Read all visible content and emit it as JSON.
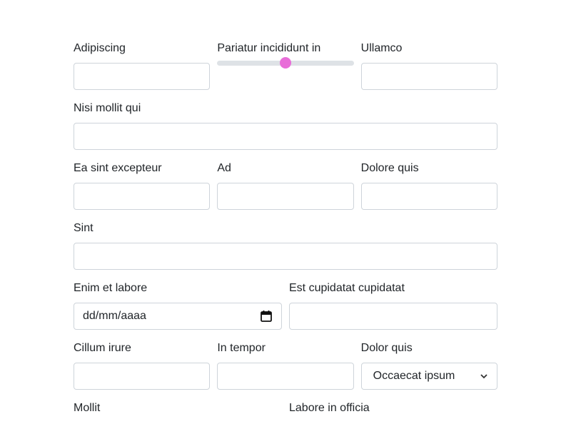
{
  "form": {
    "row1": {
      "field1": {
        "label": "Adipiscing",
        "value": ""
      },
      "slider": {
        "label": "Pariatur incididunt in",
        "value_fraction": 0.5,
        "thumb_color": "#e86dd8",
        "track_color": "#dee2e6"
      },
      "field3": {
        "label": "Ullamco",
        "value": ""
      }
    },
    "row2": {
      "field1": {
        "label": "Nisi mollit qui",
        "value": ""
      }
    },
    "row3": {
      "field1": {
        "label": "Ea sint excepteur",
        "value": ""
      },
      "field2": {
        "label": "Ad",
        "value": ""
      },
      "field3": {
        "label": "Dolore quis",
        "value": ""
      }
    },
    "row4": {
      "field1": {
        "label": "Sint",
        "value": ""
      }
    },
    "row5": {
      "date": {
        "label": "Enim et labore",
        "placeholder": "dd/mm/aaaa",
        "icon": "calendar-icon"
      },
      "field2": {
        "label": "Est cupidatat cupidatat",
        "value": ""
      }
    },
    "row6": {
      "field1": {
        "label": "Cillum irure",
        "value": ""
      },
      "field2": {
        "label": "In tempor",
        "value": ""
      },
      "select": {
        "label": "Dolor quis",
        "selected": "Occaecat ipsum",
        "icon": "chevron-down-icon"
      }
    },
    "row7": {
      "field1": {
        "label": "Mollit"
      },
      "field2": {
        "label": "Labore in officia"
      }
    }
  }
}
